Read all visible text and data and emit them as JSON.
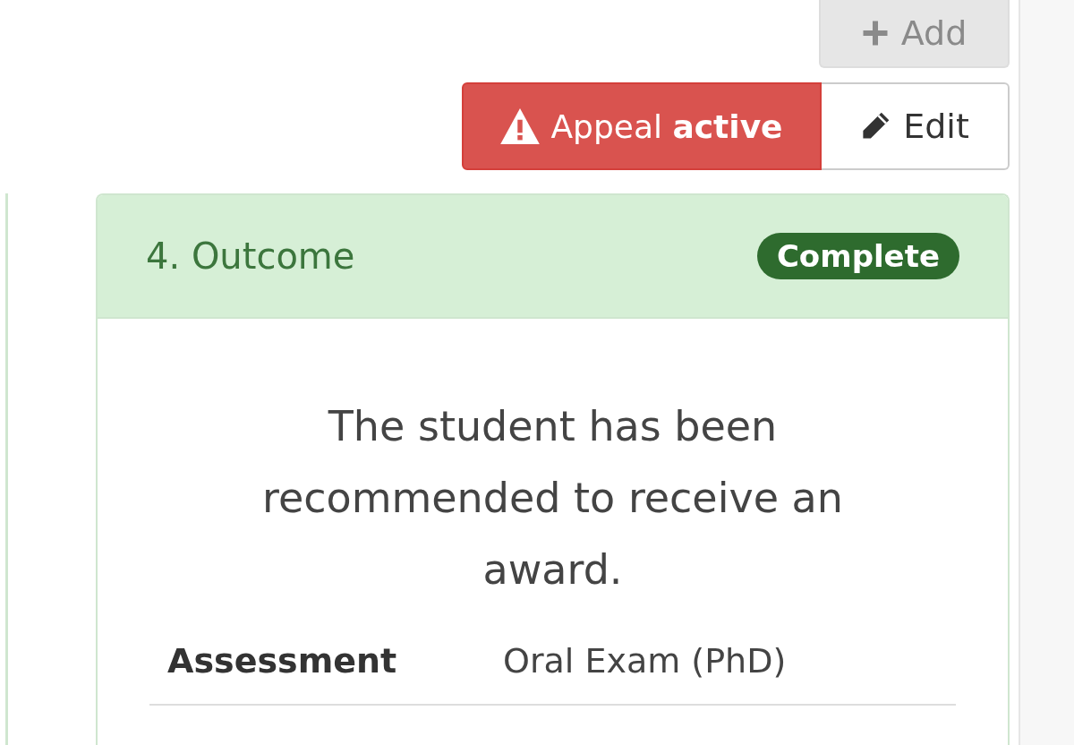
{
  "toolbar": {
    "add_button": {
      "label": "Add",
      "disabled": true
    }
  },
  "appeal_group": {
    "appeal_button": {
      "label": "Appeal **active**"
    },
    "edit_button": {
      "label": "Edit"
    }
  },
  "card": {
    "title": "4. Outcome",
    "badge": "Complete",
    "message": "The student has been recommended to receive an award.",
    "details": [
      {
        "label": "Assessment",
        "value": "Oral Exam (PhD)"
      }
    ]
  }
}
